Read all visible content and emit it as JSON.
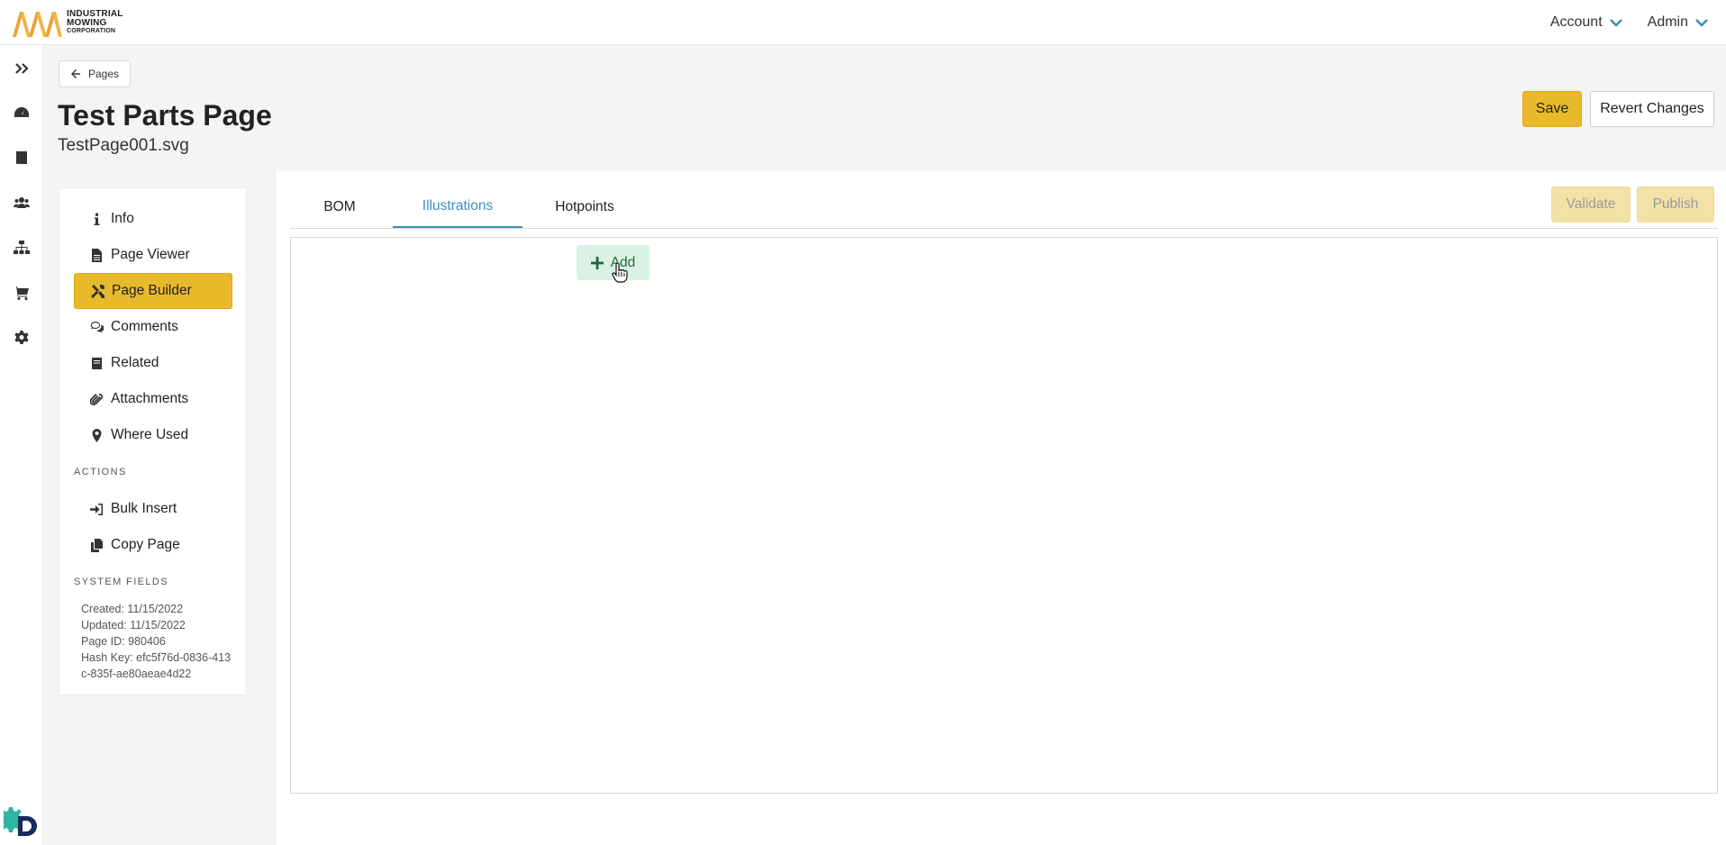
{
  "header": {
    "logo": {
      "line1": "INDUSTRIAL",
      "line2": "MOWING",
      "line3": "CORPORATION"
    },
    "menus": [
      {
        "label": "Account",
        "icon": "chevron-down-icon"
      },
      {
        "label": "Admin",
        "icon": "chevron-down-icon"
      }
    ],
    "accent": "#3d8fbf"
  },
  "rail": {
    "items": [
      {
        "icon": "double-chevron-right-icon"
      },
      {
        "icon": "dashboard-icon"
      },
      {
        "icon": "book-icon"
      },
      {
        "icon": "users-icon"
      },
      {
        "icon": "sitemap-icon"
      },
      {
        "icon": "cart-icon"
      },
      {
        "icon": "gear-icon"
      }
    ]
  },
  "page": {
    "back_label": "Pages",
    "title": "Test Parts Page",
    "subtitle": "TestPage001.svg",
    "save_label": "Save",
    "revert_label": "Revert Changes",
    "primary_color": "#e8b92a"
  },
  "nav": {
    "items": [
      {
        "label": "Info",
        "icon": "info-icon"
      },
      {
        "label": "Page Viewer",
        "icon": "file-icon"
      },
      {
        "label": "Page Builder",
        "icon": "tools-icon",
        "active": true
      },
      {
        "label": "Comments",
        "icon": "comments-icon"
      },
      {
        "label": "Related",
        "icon": "book-icon"
      },
      {
        "label": "Attachments",
        "icon": "paperclip-icon"
      },
      {
        "label": "Where Used",
        "icon": "map-marker-icon"
      }
    ],
    "actions_label": "ACTIONS",
    "actions": [
      {
        "label": "Bulk Insert",
        "icon": "sign-in-icon"
      },
      {
        "label": "Copy Page",
        "icon": "copy-icon"
      }
    ],
    "system_label": "SYSTEM FIELDS",
    "system_fields": {
      "created": "Created: 11/15/2022",
      "updated": "Updated: 11/15/2022",
      "page_id": "Page ID: 980406",
      "hash_key": "Hash Key: efc5f76d-0836-413c-835f-ae80aeae4d22"
    }
  },
  "main": {
    "tabs": [
      {
        "label": "BOM"
      },
      {
        "label": "Illustrations",
        "active": true
      },
      {
        "label": "Hotpoints"
      }
    ],
    "validate_label": "Validate",
    "publish_label": "Publish",
    "add_label": "Add"
  }
}
